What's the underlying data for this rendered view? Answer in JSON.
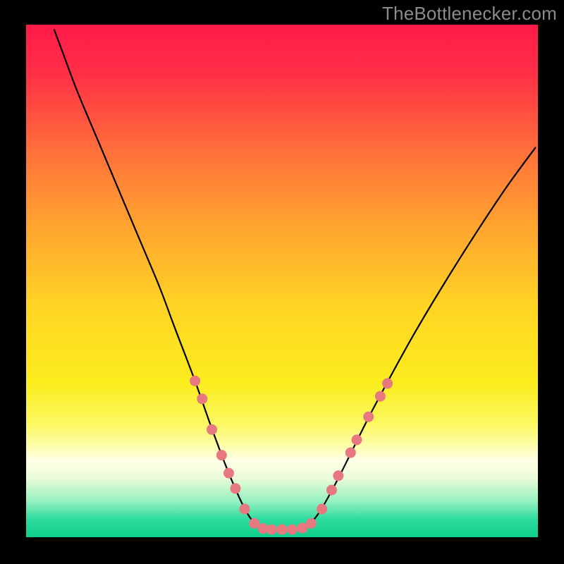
{
  "watermark_text": "TheBottlenecker.com",
  "chart_data": {
    "type": "line",
    "title": "",
    "xlabel": "",
    "ylabel": "",
    "xlim": [
      0,
      100
    ],
    "ylim": [
      0,
      100
    ],
    "background": {
      "stops": [
        {
          "offset": 0.0,
          "color": "#ff1a4a"
        },
        {
          "offset": 0.1,
          "color": "#ff3146"
        },
        {
          "offset": 0.25,
          "color": "#ff713a"
        },
        {
          "offset": 0.4,
          "color": "#ffa62f"
        },
        {
          "offset": 0.55,
          "color": "#ffd424"
        },
        {
          "offset": 0.7,
          "color": "#fbed1e"
        },
        {
          "offset": 0.78,
          "color": "#fbf863"
        },
        {
          "offset": 0.82,
          "color": "#fdfda8"
        },
        {
          "offset": 0.85,
          "color": "#ffffe6"
        },
        {
          "offset": 0.885,
          "color": "#eafcd8"
        },
        {
          "offset": 0.93,
          "color": "#95f0c0"
        },
        {
          "offset": 0.965,
          "color": "#2ddc9e"
        },
        {
          "offset": 1.0,
          "color": "#0ecf8a"
        }
      ]
    },
    "series": [
      {
        "name": "bottleneck-curve",
        "color": "#000000",
        "width": 2.2,
        "points": [
          {
            "x": 5.5,
            "y": 99.0
          },
          {
            "x": 7.0,
            "y": 95.0
          },
          {
            "x": 10.0,
            "y": 87.0
          },
          {
            "x": 14.0,
            "y": 77.5
          },
          {
            "x": 18.0,
            "y": 68.0
          },
          {
            "x": 22.0,
            "y": 58.5
          },
          {
            "x": 26.0,
            "y": 49.0
          },
          {
            "x": 29.0,
            "y": 41.0
          },
          {
            "x": 33.0,
            "y": 30.5
          },
          {
            "x": 36.0,
            "y": 22.0
          },
          {
            "x": 39.0,
            "y": 14.0
          },
          {
            "x": 42.0,
            "y": 7.0
          },
          {
            "x": 44.0,
            "y": 3.5
          },
          {
            "x": 46.0,
            "y": 1.8
          },
          {
            "x": 48.0,
            "y": 1.5
          },
          {
            "x": 50.0,
            "y": 1.5
          },
          {
            "x": 52.0,
            "y": 1.5
          },
          {
            "x": 54.0,
            "y": 1.8
          },
          {
            "x": 56.0,
            "y": 3.2
          },
          {
            "x": 58.0,
            "y": 6.0
          },
          {
            "x": 61.0,
            "y": 11.5
          },
          {
            "x": 64.0,
            "y": 17.5
          },
          {
            "x": 67.0,
            "y": 23.5
          },
          {
            "x": 71.0,
            "y": 31.0
          },
          {
            "x": 76.0,
            "y": 40.0
          },
          {
            "x": 82.0,
            "y": 50.0
          },
          {
            "x": 88.0,
            "y": 59.5
          },
          {
            "x": 94.0,
            "y": 68.5
          },
          {
            "x": 99.5,
            "y": 76.0
          }
        ]
      }
    ],
    "markers": {
      "color": "#e77880",
      "radius": 7.5,
      "points": [
        {
          "x": 33.0,
          "y": 30.5
        },
        {
          "x": 34.4,
          "y": 27.0
        },
        {
          "x": 36.3,
          "y": 21.0
        },
        {
          "x": 38.2,
          "y": 16.0
        },
        {
          "x": 39.6,
          "y": 12.5
        },
        {
          "x": 40.9,
          "y": 9.5
        },
        {
          "x": 42.7,
          "y": 5.5
        },
        {
          "x": 44.6,
          "y": 2.7
        },
        {
          "x": 46.3,
          "y": 1.7
        },
        {
          "x": 48.0,
          "y": 1.5
        },
        {
          "x": 50.0,
          "y": 1.5
        },
        {
          "x": 52.0,
          "y": 1.5
        },
        {
          "x": 54.0,
          "y": 1.8
        },
        {
          "x": 55.7,
          "y": 2.7
        },
        {
          "x": 57.8,
          "y": 5.5
        },
        {
          "x": 59.7,
          "y": 9.2
        },
        {
          "x": 61.0,
          "y": 12.0
        },
        {
          "x": 63.4,
          "y": 16.5
        },
        {
          "x": 64.6,
          "y": 19.0
        },
        {
          "x": 66.9,
          "y": 23.5
        },
        {
          "x": 69.2,
          "y": 27.5
        },
        {
          "x": 70.6,
          "y": 30.0
        }
      ]
    }
  }
}
